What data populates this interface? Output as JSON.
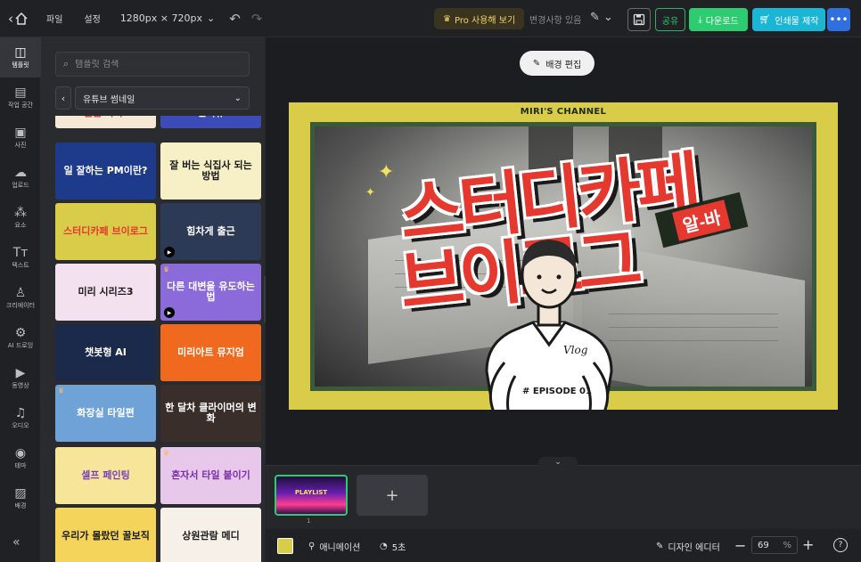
{
  "topbar": {
    "menu_file": "파일",
    "menu_settings": "설정",
    "canvas_size": "1280px × 720px",
    "pro_button": "Pro 사용해 보기",
    "changes_status": "변경사항 있음",
    "share": "공유",
    "download": "다운로드",
    "print": "인쇄물 제작"
  },
  "rail": [
    {
      "label": "템플릿",
      "icon": "template-icon",
      "active": true
    },
    {
      "label": "작업 공간",
      "icon": "workspace-icon"
    },
    {
      "label": "사진",
      "icon": "photo-icon"
    },
    {
      "label": "업로드",
      "icon": "upload-icon"
    },
    {
      "label": "요소",
      "icon": "elements-icon"
    },
    {
      "label": "텍스트",
      "icon": "text-icon"
    },
    {
      "label": "크리에이터",
      "icon": "creator-icon"
    },
    {
      "label": "AI 드로잉",
      "icon": "ai-drawing-icon"
    },
    {
      "label": "동영상",
      "icon": "video-icon"
    },
    {
      "label": "오디오",
      "icon": "audio-icon"
    },
    {
      "label": "테마",
      "icon": "theme-icon"
    },
    {
      "label": "배경",
      "icon": "background-icon"
    }
  ],
  "panel": {
    "search_placeholder": "템플릿 검색",
    "category": "유튜브 썸네일",
    "thumbnails": [
      {
        "text": "쌀쌀 가자!",
        "bg": "#f5e9d6",
        "fg": "#d8382f"
      },
      {
        "text": "인터뷰",
        "bg": "#3b4cb8",
        "fg": "#ffffff"
      },
      {
        "text": "일 잘하는 PM이란?",
        "bg": "#1e3a8a",
        "fg": "#ffffff"
      },
      {
        "text": "잘 버는 식집사 되는 방법",
        "bg": "#f7efc6",
        "fg": "#1a1a1a"
      },
      {
        "text": "스터디카페 브이로그",
        "bg": "#d9cc49",
        "fg": "#e5382f"
      },
      {
        "text": "힘차게 출근",
        "bg": "#2c3a55",
        "fg": "#ffffff"
      },
      {
        "text": "미리 시리즈3",
        "bg": "#f4e1ef",
        "fg": "#1a1a1a"
      },
      {
        "text": "다른 대변을 유도하는 법",
        "bg": "#8b6ad9",
        "fg": "#ffffff"
      },
      {
        "text": "챗봇형 AI",
        "bg": "#1b2a4a",
        "fg": "#ffffff"
      },
      {
        "text": "미리아트 뮤지엄",
        "bg": "#ef6a1e",
        "fg": "#ffffff"
      },
      {
        "text": "화장실 타일편",
        "bg": "#6fa3d8",
        "fg": "#ffffff"
      },
      {
        "text": "한 달차 클라이머의 변화",
        "bg": "#3a2e2a",
        "fg": "#ffffff"
      },
      {
        "text": "셀프 페인팅",
        "bg": "#f7e59a",
        "fg": "#7a3fb8"
      },
      {
        "text": "혼자서 타일 붙이기",
        "bg": "#e8c8ea",
        "fg": "#7a2ea8"
      },
      {
        "text": "우리가 몰랐던 꿀보직",
        "bg": "#f4d45a",
        "fg": "#1a1a1a"
      },
      {
        "text": "상원관람 메디",
        "bg": "#f7f0e8",
        "fg": "#1a1a1a"
      }
    ]
  },
  "canvas": {
    "bg_edit": "배경 편집",
    "channel": "MIRI'S CHANNEL",
    "title_line1": "스터디카페",
    "title_line2": "브이로그",
    "tag": "알-바",
    "shirt_text": "Vlog",
    "episode": "# EPISODE 01",
    "bg_color": "#d9cc49",
    "accent": "#e5382f"
  },
  "pages": {
    "thumb_title": "PLAYLIST",
    "page_number": "1"
  },
  "bottombar": {
    "animation": "애니메이션",
    "duration": "5초",
    "designer": "디자인 에디터",
    "zoom": "69",
    "zoom_unit": "%"
  }
}
